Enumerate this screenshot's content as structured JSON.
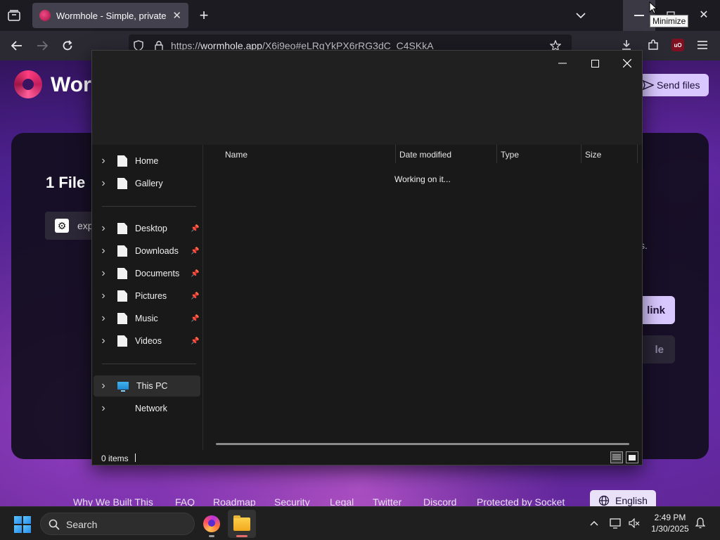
{
  "browser": {
    "tab_title": "Wormhole - Simple, private file sharing",
    "url_prefix": "https://",
    "url_host": "wormhole.app",
    "url_path": "/X6i9eo#eLRqYkPX6rRG3dC_C4SKkA",
    "tooltip": "Minimize"
  },
  "page": {
    "logo_text": "Wormhole",
    "send_files_label": "Send files",
    "card_title": "1 File",
    "file_name": "exp",
    "card_fragment": "s.",
    "primary_btn_fragment": "link",
    "secondary_btn_fragment": "le",
    "footer_links": [
      "Why We Built This",
      "FAQ",
      "Roadmap",
      "Security",
      "Legal",
      "Twitter",
      "Discord",
      "Protected by Socket"
    ],
    "language": "English"
  },
  "dialog": {
    "nav_items": [
      {
        "label": "Home",
        "icon": "document-icon",
        "pinned": false
      },
      {
        "label": "Gallery",
        "icon": "document-icon",
        "pinned": false
      },
      {
        "label": "Desktop",
        "icon": "document-icon",
        "pinned": true
      },
      {
        "label": "Downloads",
        "icon": "document-icon",
        "pinned": true
      },
      {
        "label": "Documents",
        "icon": "document-icon",
        "pinned": true
      },
      {
        "label": "Pictures",
        "icon": "document-icon",
        "pinned": true
      },
      {
        "label": "Music",
        "icon": "document-icon",
        "pinned": true
      },
      {
        "label": "Videos",
        "icon": "document-icon",
        "pinned": true
      },
      {
        "label": "This PC",
        "icon": "computer-icon",
        "pinned": false,
        "selected": true
      },
      {
        "label": "Network",
        "icon": "network-icon",
        "pinned": false
      }
    ],
    "columns": [
      "Name",
      "Date modified",
      "Type",
      "Size"
    ],
    "loading_text": "Working on it...",
    "status_text": "0 items"
  },
  "taskbar": {
    "search_label": "Search",
    "time": "2:49 PM",
    "date": "1/30/2025"
  }
}
